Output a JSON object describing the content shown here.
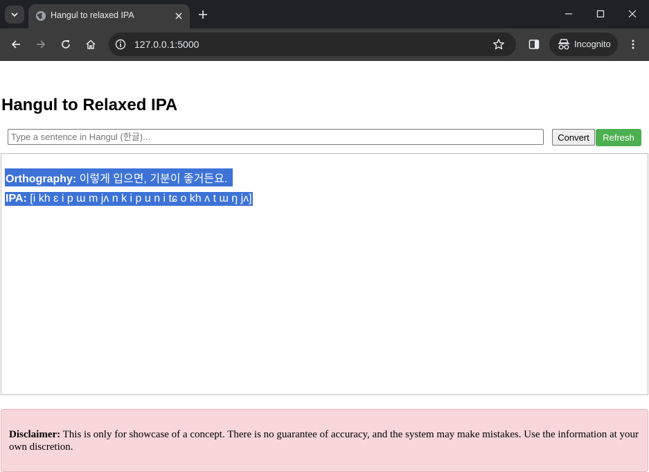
{
  "browser": {
    "tab_title": "Hangul to relaxed IPA",
    "url": "127.0.0.1:5000",
    "incognito_label": "Incognito"
  },
  "page": {
    "title": "Hangul to Relaxed IPA",
    "input": {
      "placeholder": "Type a sentence in Hangul (한글)...",
      "value": ""
    },
    "convert_label": "Convert",
    "refresh_label": "Refresh",
    "refresh_color": "#4caf50",
    "result": {
      "orthography_label": "Orthography:",
      "orthography_value": "이렇게 입으면, 기분이 좋거든요.",
      "ipa_label": "IPA:",
      "ipa_value": "[i kh ɛ i p ɯ m jʌ n k i p u n i tɕ o kh ʌ t ɯ ŋ jʌ]"
    },
    "disclaimer": {
      "label": "Disclaimer:",
      "text": "This is only for showcase of a concept. There is no guarantee of accuracy, and the system may make mistakes. Use the information at your own discretion."
    }
  }
}
